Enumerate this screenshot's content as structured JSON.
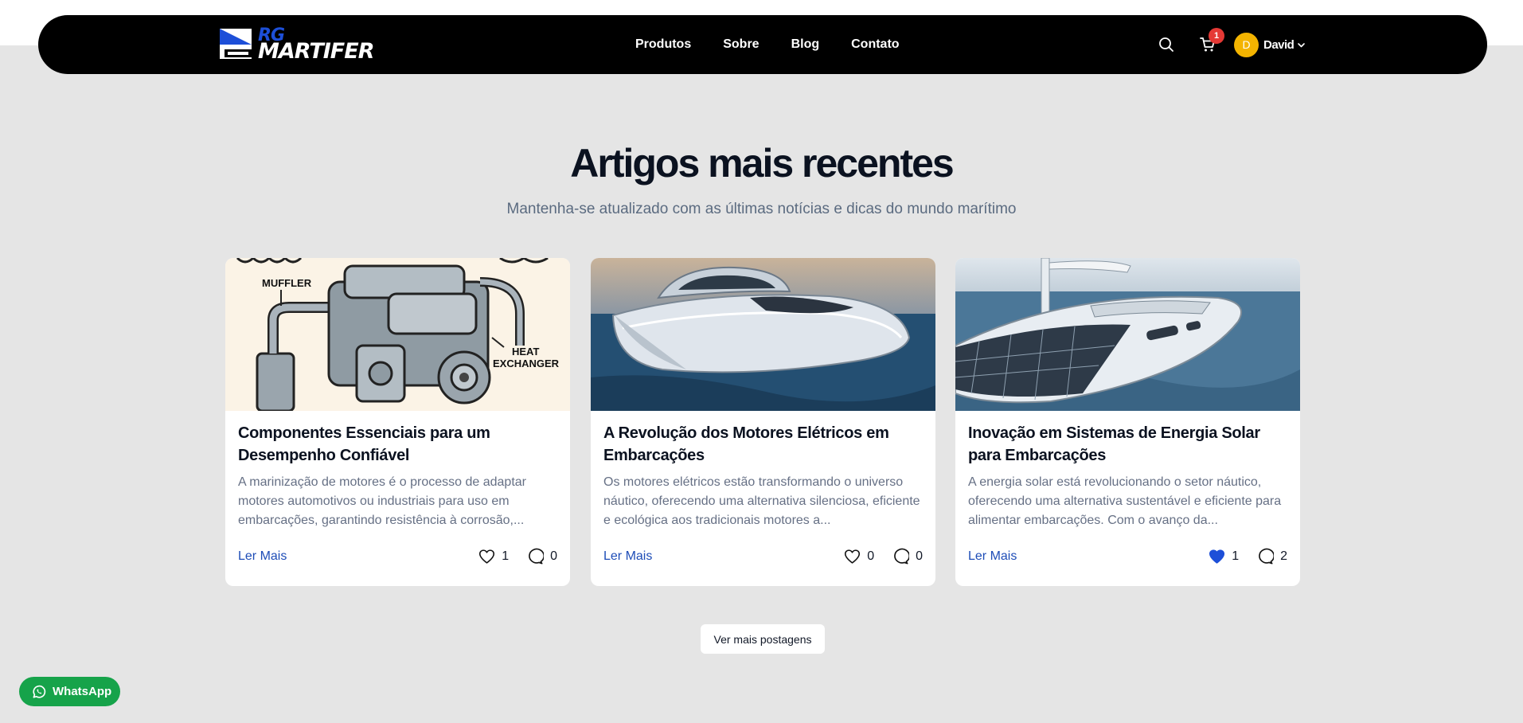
{
  "brand": {
    "logo_top": "RG",
    "logo_bottom": "MARTIFER",
    "accent": "#1d4fd8"
  },
  "nav": {
    "links": [
      "Produtos",
      "Sobre",
      "Blog",
      "Contato"
    ],
    "search_icon": "search-icon",
    "cart_icon": "cart-icon",
    "cart_count": "1",
    "user_initial": "D",
    "user_name": "David"
  },
  "section": {
    "title": "Artigos mais recentes",
    "subtitle": "Mantenha-se atualizado com as últimas notícias e dicas do mundo marítimo"
  },
  "posts": [
    {
      "title": "Componentes Essenciais para um Desempenho Confiável",
      "excerpt": "A marinização de motores é o processo de adaptar motores automotivos ou industriais para uso em embarcações, garantindo resistência à corrosão,...",
      "read_more": "Ler Mais",
      "likes": "1",
      "comments": "0",
      "liked": false,
      "image_labels": [
        "MUFFLER",
        "HEAT",
        "EXCHANGER"
      ]
    },
    {
      "title": "A Revolução dos Motores Elétricos em Embarcações",
      "excerpt": "Os motores elétricos estão transformando o universo náutico, oferecendo uma alternativa silenciosa, eficiente e ecológica aos tradicionais motores a...",
      "read_more": "Ler Mais",
      "likes": "0",
      "comments": "0",
      "liked": false
    },
    {
      "title": "Inovação em Sistemas de Energia Solar para Embarcações",
      "excerpt": "A energia solar está revolucionando o setor náutico, oferecendo uma alternativa sustentável e eficiente para alimentar embarcações. Com o avanço da...",
      "read_more": "Ler Mais",
      "likes": "1",
      "comments": "2",
      "liked": true
    }
  ],
  "more_button": "Ver mais postagens",
  "whatsapp": {
    "label": "WhatsApp",
    "color": "#16a34a"
  }
}
